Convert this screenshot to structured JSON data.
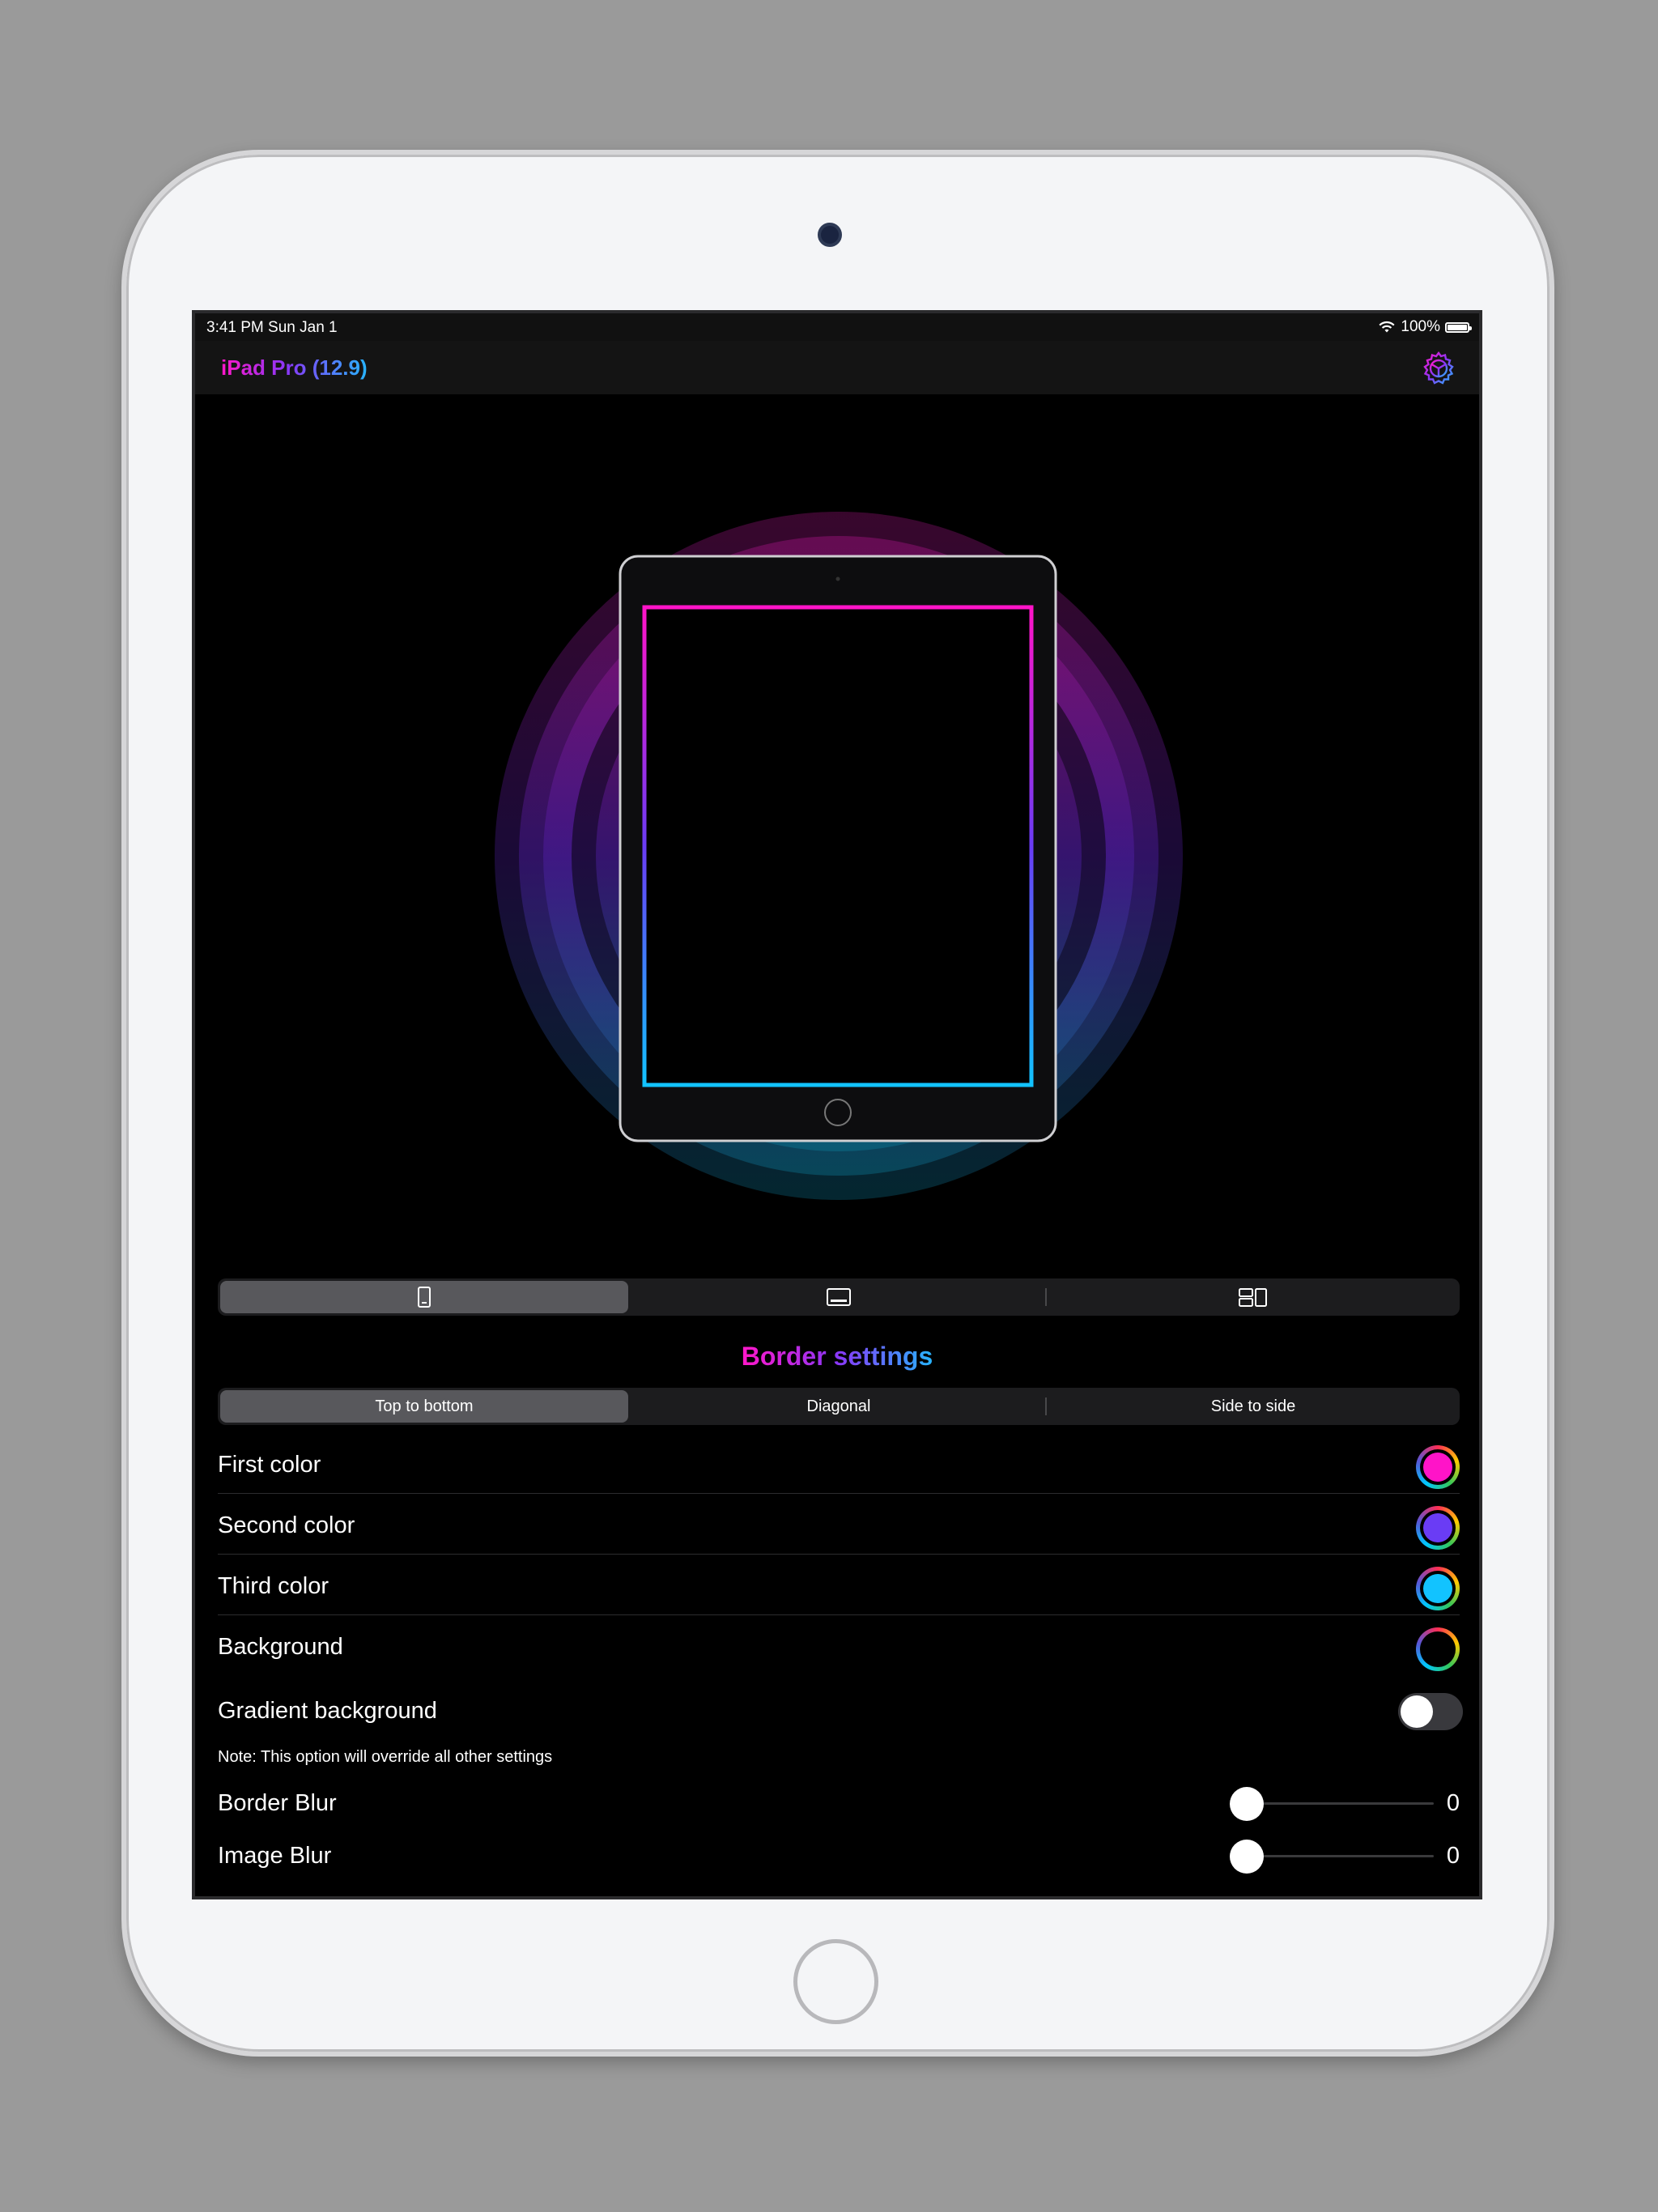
{
  "status": {
    "time": "3:41 PM   Sun Jan 1",
    "battery": "100%"
  },
  "nav": {
    "title": "iPad Pro (12.9)",
    "settings_icon": "gear-icon"
  },
  "orientation_tabs": [
    {
      "icon": "portrait-icon",
      "selected": true
    },
    {
      "icon": "landscape-icon",
      "selected": false
    },
    {
      "icon": "split-view-icon",
      "selected": false
    }
  ],
  "section_title": "Border settings",
  "direction_tabs": [
    {
      "label": "Top to bottom",
      "selected": true
    },
    {
      "label": "Diagonal",
      "selected": false
    },
    {
      "label": "Side to side",
      "selected": false
    }
  ],
  "colors": [
    {
      "label": "First color",
      "color": "#ff14c8"
    },
    {
      "label": "Second color",
      "color": "#6a3cf5"
    },
    {
      "label": "Third color",
      "color": "#12c3ff"
    },
    {
      "label": "Background",
      "color": "#000000"
    }
  ],
  "gradient_background": {
    "label": "Gradient background",
    "on": false,
    "note": "Note: This option will override all other settings"
  },
  "sliders": [
    {
      "label": "Border Blur",
      "value": "0"
    },
    {
      "label": "Image Blur",
      "value": "0"
    }
  ]
}
